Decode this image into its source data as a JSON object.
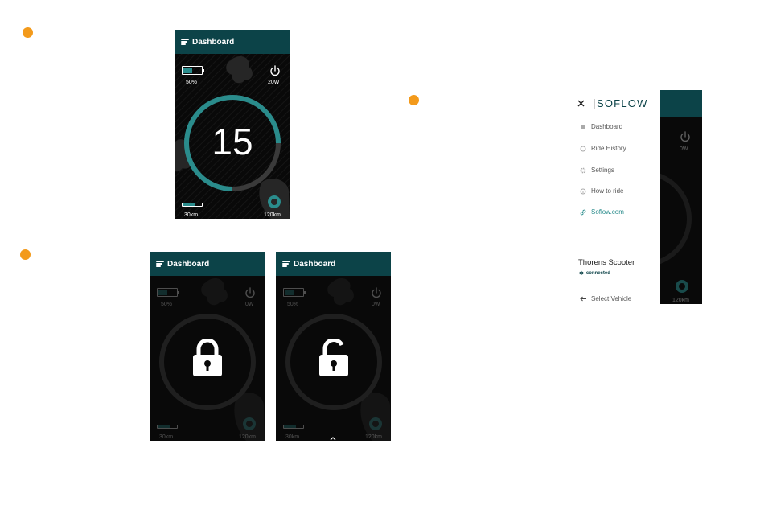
{
  "colors": {
    "accent": "#2a8c8c",
    "header": "#0c4348",
    "step_marker": "#f39a1b",
    "screen_bg": "#090909"
  },
  "screens": {
    "dashboard": {
      "title": "Dashboard",
      "battery_percent": "50%",
      "battery_fraction": 0.5,
      "power": "20W",
      "speed": "15",
      "range_ridden": "30km",
      "range_total": "120km",
      "range_fraction": 0.3
    },
    "locked": {
      "title": "Dashboard",
      "battery_percent": "50%",
      "power": "0W",
      "range_ridden": "30km",
      "range_total": "120km",
      "lock_icon": "lock-closed-icon"
    },
    "unlocked": {
      "title": "Dashboard",
      "battery_percent": "50%",
      "power": "0W",
      "range_ridden": "30km",
      "range_total": "120km",
      "lock_icon": "lock-open-icon"
    },
    "menu": {
      "brand": "SOFLOW",
      "items": [
        {
          "label": "Dashboard",
          "icon": "dashboard-icon"
        },
        {
          "label": "Ride History",
          "icon": "history-icon"
        },
        {
          "label": "Settings",
          "icon": "gear-icon"
        },
        {
          "label": "How to ride",
          "icon": "info-icon"
        },
        {
          "label": "Soflow.com",
          "icon": "link-icon"
        }
      ],
      "vehicle_name": "Thorens Scooter",
      "vehicle_status": "connected",
      "select_vehicle": "Select Vehicle",
      "peek_power": "0W",
      "peek_range": "120km"
    }
  }
}
